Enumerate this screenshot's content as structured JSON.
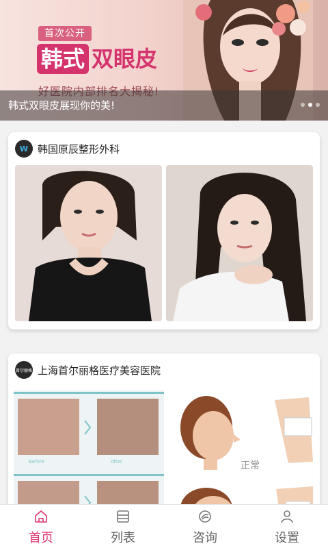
{
  "banner": {
    "tag": "首次公开",
    "title_highlight": "韩式",
    "title_rest": "双眼皮",
    "subtitle": "好医院内部排名大揭秘!",
    "caption": "韩式双眼皮展现你的美!",
    "page_count": 3,
    "active_page": 2
  },
  "cards": [
    {
      "hospital": "韩国原辰整形外科",
      "logo_text": "W"
    },
    {
      "hospital": "上海首尔丽格医疗美容医院",
      "logo_text": "首尔丽格",
      "before_label": "Before",
      "after_label": "After",
      "normal_label": "正常"
    }
  ],
  "tabs": [
    {
      "label": "首页",
      "icon": "home-icon",
      "active": true
    },
    {
      "label": "列表",
      "icon": "list-icon",
      "active": false
    },
    {
      "label": "咨询",
      "icon": "consult-icon",
      "active": false
    },
    {
      "label": "设置",
      "icon": "profile-icon",
      "active": false
    }
  ],
  "colors": {
    "accent": "#e0356f",
    "tab_inactive": "#666666"
  }
}
